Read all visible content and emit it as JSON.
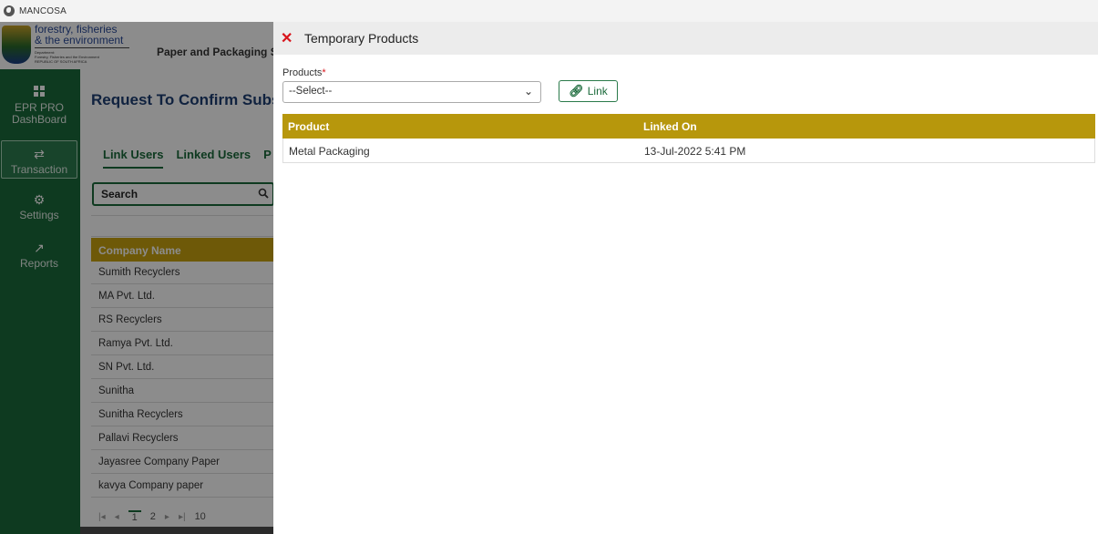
{
  "browser": {
    "tab_title": "MANCOSA",
    "tab_icon": "globe-icon"
  },
  "logo": {
    "line1": "forestry, fisheries",
    "line2": "& the environment",
    "line3": "Department:",
    "line4": "Forestry, Fisheries and the Environment",
    "line5": "REPUBLIC OF SOUTH AFRICA"
  },
  "header": {
    "title": "Paper and Packaging Sec"
  },
  "sidebar": {
    "items": [
      {
        "label": "EPR PRO DashBoard",
        "icon": "dashboard-grid-icon"
      },
      {
        "label": "Transaction",
        "icon": "exchange-arrows-icon"
      },
      {
        "label": "Settings",
        "icon": "gears-icon"
      },
      {
        "label": "Reports",
        "icon": "line-chart-icon"
      }
    ]
  },
  "background_page": {
    "title": "Request To Confirm Subscri",
    "tabs": [
      "Link Users",
      "Linked Users",
      "P"
    ],
    "search_placeholder": "Search",
    "table_header": "Company Name",
    "rows": [
      "Sumith Recyclers",
      "MA Pvt. Ltd.",
      "RS Recyclers",
      "Ramya Pvt. Ltd.",
      "SN Pvt. Ltd.",
      "Sunitha",
      "Sunitha Recyclers",
      "Pallavi Recyclers",
      "Jayasree Company Paper",
      "kavya Company paper"
    ],
    "pager": {
      "pages": [
        "1",
        "2"
      ],
      "page_size": "10"
    }
  },
  "panel": {
    "title": "Temporary Products",
    "products_label": "Products",
    "required_mark": "*",
    "select_value": "--Select--",
    "link_button": "Link",
    "columns": [
      "Product",
      "Linked On"
    ],
    "rows": [
      {
        "product": "Metal Packaging",
        "linked_on": "13-Jul-2022 5:41 PM"
      }
    ]
  },
  "colors": {
    "sidebar_green": "#1b6a3b",
    "gold_header": "#b7970c",
    "close_red": "#d8141b",
    "title_blue": "#1e3f73"
  }
}
